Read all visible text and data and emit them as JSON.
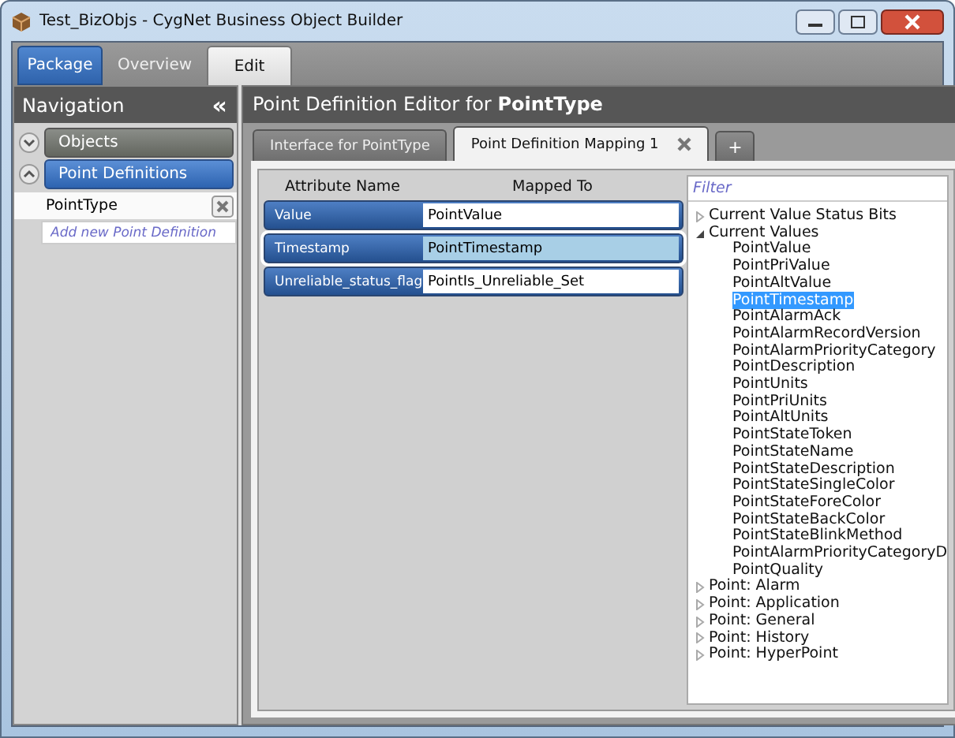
{
  "window": {
    "title": "Test_BizObjs - CygNet Business Object Builder"
  },
  "ribbon_tabs": [
    {
      "label": "Package",
      "kind": "app"
    },
    {
      "label": "Overview",
      "kind": "tab",
      "selected": false
    },
    {
      "label": "Edit",
      "kind": "tab",
      "selected": true
    }
  ],
  "navigation": {
    "title": "Navigation",
    "collapse_glyph": "«",
    "sections": [
      {
        "label": "Objects",
        "expanded": false,
        "selected": false
      },
      {
        "label": "Point Definitions",
        "expanded": true,
        "selected": true,
        "items": [
          {
            "label": "PointType",
            "selected": true
          }
        ],
        "add_placeholder": "Add new Point Definition"
      }
    ]
  },
  "editor": {
    "title": "Point Definition Editor for **PointType**",
    "tabs": [
      {
        "label": "Interface for PointType",
        "selected": false,
        "closable": false
      },
      {
        "label": "Point Definition Mapping 1",
        "selected": true,
        "closable": true
      }
    ],
    "add_tab": "+",
    "columns": [
      "Attribute Name",
      "Mapped To"
    ],
    "rows": [
      {
        "attribute": "Value",
        "mapped": "PointValue",
        "selected": false
      },
      {
        "attribute": "Timestamp",
        "mapped": "PointTimestamp",
        "selected": true
      },
      {
        "attribute": "Unreliable_status_flag",
        "mapped": "PointIs_Unreliable_Set",
        "selected": false
      }
    ],
    "filter": {
      "placeholder": "Filter"
    },
    "tree": [
      {
        "label": "Current Value Status Bits",
        "expanded": false
      },
      {
        "label": "Current Values",
        "expanded": true,
        "children": [
          {
            "label": "PointValue",
            "selected": false
          },
          {
            "label": "PointPriValue",
            "selected": false
          },
          {
            "label": "PointAltValue",
            "selected": false
          },
          {
            "label": "PointTimestamp",
            "selected": true
          },
          {
            "label": "PointAlarmAck",
            "selected": false
          },
          {
            "label": "PointAlarmRecordVersion",
            "selected": false
          },
          {
            "label": "PointAlarmPriorityCategory",
            "selected": false
          },
          {
            "label": "PointDescription",
            "selected": false
          },
          {
            "label": "PointUnits",
            "selected": false
          },
          {
            "label": "PointPriUnits",
            "selected": false
          },
          {
            "label": "PointAltUnits",
            "selected": false
          },
          {
            "label": "PointStateToken",
            "selected": false
          },
          {
            "label": "PointStateName",
            "selected": false
          },
          {
            "label": "PointStateDescription",
            "selected": false
          },
          {
            "label": "PointStateSingleColor",
            "selected": false
          },
          {
            "label": "PointStateForeColor",
            "selected": false
          },
          {
            "label": "PointStateBackColor",
            "selected": false
          },
          {
            "label": "PointStateBlinkMethod",
            "selected": false
          },
          {
            "label": "PointAlarmPriorityCategoryD",
            "selected": false
          },
          {
            "label": "PointQuality",
            "selected": false
          }
        ]
      },
      {
        "label": "Point: Alarm",
        "expanded": false
      },
      {
        "label": "Point: Application",
        "expanded": false
      },
      {
        "label": "Point: General",
        "expanded": false
      },
      {
        "label": "Point: History",
        "expanded": false
      },
      {
        "label": "Point: HyperPoint",
        "expanded": false
      }
    ]
  }
}
